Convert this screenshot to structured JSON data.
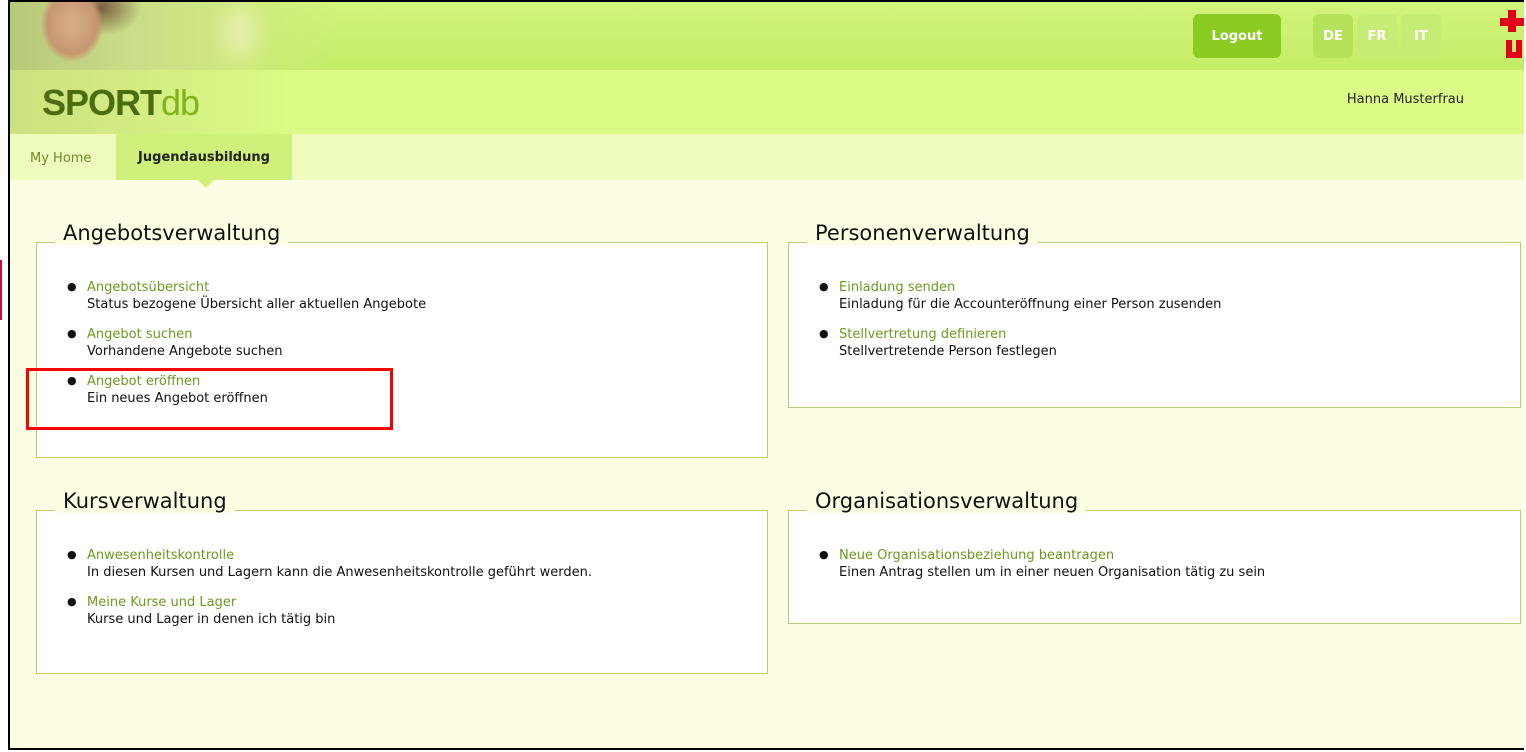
{
  "header": {
    "logo_part1": "SPORT",
    "logo_part2": "db",
    "user_name": "Hanna Musterfrau",
    "logout_label": "Logout",
    "languages": [
      "DE",
      "FR",
      "IT"
    ],
    "active_language": "DE"
  },
  "nav": {
    "tabs": [
      {
        "label": "My Home",
        "active": false
      },
      {
        "label": "Jugendausbildung",
        "active": true
      }
    ]
  },
  "panels": {
    "angebotsverwaltung": {
      "title": "Angebotsverwaltung",
      "items": [
        {
          "link": "Angebotsübersicht",
          "desc": "Status bezogene Übersicht aller aktuellen Angebote"
        },
        {
          "link": "Angebot suchen",
          "desc": "Vorhandene Angebote suchen"
        },
        {
          "link": "Angebot eröffnen",
          "desc": "Ein neues Angebot eröffnen"
        }
      ]
    },
    "personenverwaltung": {
      "title": "Personenverwaltung",
      "items": [
        {
          "link": "Einladung senden",
          "desc": "Einladung für die Accounteröffnung einer Person zusenden"
        },
        {
          "link": "Stellvertretung definieren",
          "desc": "Stellvertretende Person festlegen"
        }
      ]
    },
    "kursverwaltung": {
      "title": "Kursverwaltung",
      "items": [
        {
          "link": "Anwesenheitskontrolle",
          "desc": "In diesen Kursen und Lagern kann die Anwesenheitskontrolle geführt werden."
        },
        {
          "link": "Meine Kurse und Lager",
          "desc": "Kurse und Lager in denen ich tätig bin"
        }
      ]
    },
    "organisationsverwaltung": {
      "title": "Organisationsverwaltung",
      "items": [
        {
          "link": "Neue Organisationsbeziehung beantragen",
          "desc": "Einen Antrag stellen um in einer neuen Organisation tätig zu sein"
        }
      ]
    }
  },
  "colors": {
    "header_green": "#c4ec66",
    "link_green": "#6c9a1e",
    "highlight_red": "#ff0000"
  }
}
